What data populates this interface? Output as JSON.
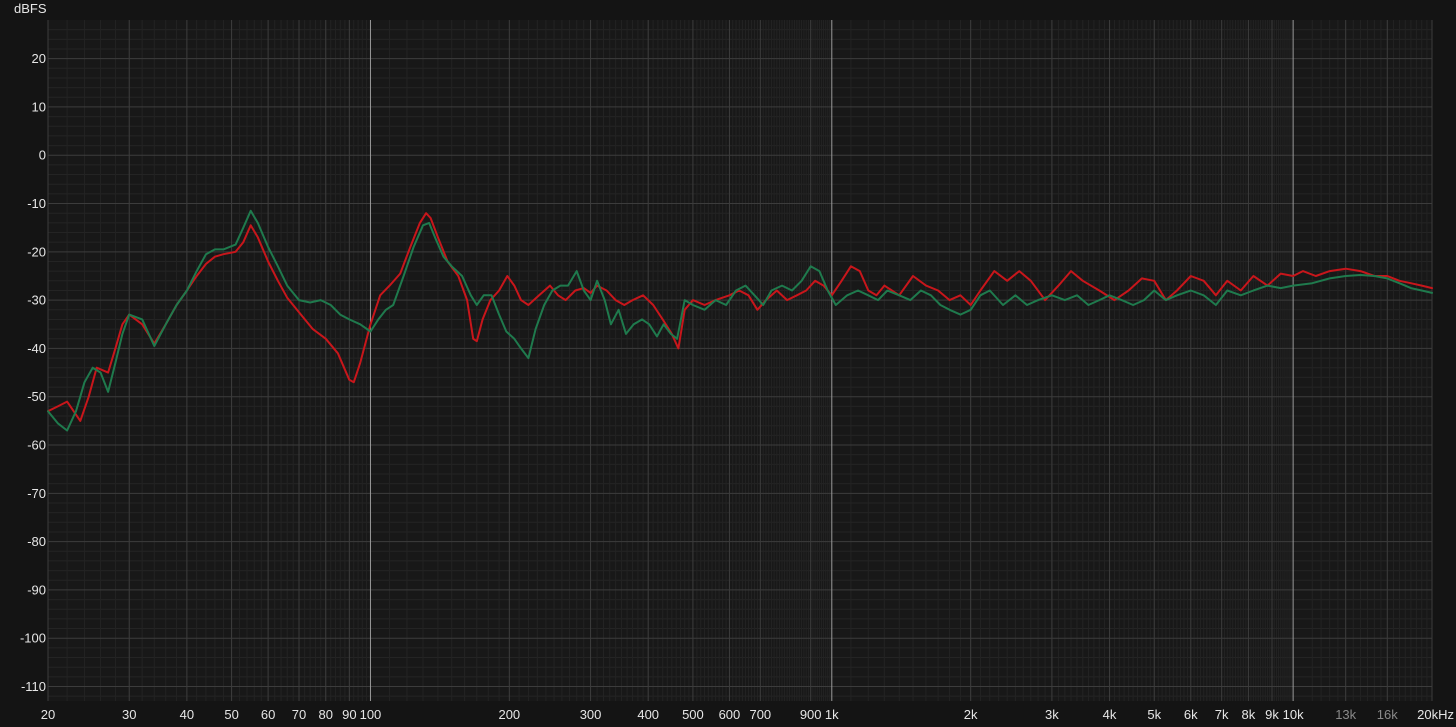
{
  "chart_data": {
    "type": "line",
    "ylabel": "dBFS",
    "xscale": "log",
    "xlim": [
      20,
      20000
    ],
    "ylim": [
      -113,
      28
    ],
    "grid": true,
    "x_ticks": [
      {
        "value": 20,
        "label": "20"
      },
      {
        "value": 30,
        "label": "30"
      },
      {
        "value": 40,
        "label": "40"
      },
      {
        "value": 50,
        "label": "50"
      },
      {
        "value": 60,
        "label": "60"
      },
      {
        "value": 70,
        "label": "70"
      },
      {
        "value": 80,
        "label": "80"
      },
      {
        "value": 90,
        "label": "90"
      },
      {
        "value": 100,
        "label": "100"
      },
      {
        "value": 200,
        "label": "200"
      },
      {
        "value": 300,
        "label": "300"
      },
      {
        "value": 400,
        "label": "400"
      },
      {
        "value": 500,
        "label": "500"
      },
      {
        "value": 600,
        "label": "600"
      },
      {
        "value": 700,
        "label": "700"
      },
      {
        "value": 900,
        "label": "900"
      },
      {
        "value": 1000,
        "label": "1k"
      },
      {
        "value": 2000,
        "label": "2k"
      },
      {
        "value": 3000,
        "label": "3k"
      },
      {
        "value": 4000,
        "label": "4k"
      },
      {
        "value": 5000,
        "label": "5k"
      },
      {
        "value": 6000,
        "label": "6k"
      },
      {
        "value": 7000,
        "label": "7k"
      },
      {
        "value": 8000,
        "label": "8k"
      },
      {
        "value": 9000,
        "label": "9k"
      },
      {
        "value": 10000,
        "label": "10k"
      },
      {
        "value": 13000,
        "label": "13k",
        "dim": true
      },
      {
        "value": 16000,
        "label": "16k",
        "dim": true
      },
      {
        "value": 20000,
        "label": "20kHz"
      }
    ],
    "y_ticks": [
      {
        "value": 20,
        "label": "20"
      },
      {
        "value": 10,
        "label": "10"
      },
      {
        "value": 0,
        "label": "0"
      },
      {
        "value": -10,
        "label": "-10"
      },
      {
        "value": -20,
        "label": "-20"
      },
      {
        "value": -30,
        "label": "-30"
      },
      {
        "value": -40,
        "label": "-40"
      },
      {
        "value": -50,
        "label": "-50"
      },
      {
        "value": -60,
        "label": "-60"
      },
      {
        "value": -70,
        "label": "-70"
      },
      {
        "value": -80,
        "label": "-80"
      },
      {
        "value": -90,
        "label": "-90"
      },
      {
        "value": -100,
        "label": "-100"
      },
      {
        "value": -110,
        "label": "-110"
      }
    ],
    "series": [
      {
        "color": "#c8161b",
        "points": [
          [
            20,
            -53
          ],
          [
            21,
            -52
          ],
          [
            22,
            -51
          ],
          [
            23.5,
            -55
          ],
          [
            24.5,
            -50
          ],
          [
            25.5,
            -44
          ],
          [
            27,
            -45
          ],
          [
            28,
            -40
          ],
          [
            29,
            -35
          ],
          [
            30,
            -33
          ],
          [
            32,
            -35
          ],
          [
            34,
            -39
          ],
          [
            36,
            -35
          ],
          [
            38,
            -31
          ],
          [
            40,
            -28
          ],
          [
            42,
            -25
          ],
          [
            44,
            -22.5
          ],
          [
            46,
            -21
          ],
          [
            48,
            -20.5
          ],
          [
            51,
            -20
          ],
          [
            53,
            -18
          ],
          [
            55,
            -14.5
          ],
          [
            57,
            -17
          ],
          [
            60,
            -22
          ],
          [
            63,
            -26
          ],
          [
            66,
            -29.5
          ],
          [
            70,
            -32.5
          ],
          [
            75,
            -36
          ],
          [
            80,
            -38
          ],
          [
            85,
            -41
          ],
          [
            90,
            -46.5
          ],
          [
            92,
            -47
          ],
          [
            95,
            -43
          ],
          [
            100,
            -35
          ],
          [
            105,
            -29
          ],
          [
            110,
            -27
          ],
          [
            116,
            -24.5
          ],
          [
            122,
            -19
          ],
          [
            128,
            -14
          ],
          [
            132,
            -12
          ],
          [
            135,
            -13
          ],
          [
            140,
            -17
          ],
          [
            147,
            -22
          ],
          [
            155,
            -25
          ],
          [
            162,
            -30
          ],
          [
            167,
            -38
          ],
          [
            170,
            -38.5
          ],
          [
            175,
            -34
          ],
          [
            182,
            -30
          ],
          [
            190,
            -28
          ],
          [
            198,
            -25
          ],
          [
            205,
            -27
          ],
          [
            212,
            -30
          ],
          [
            220,
            -31
          ],
          [
            232,
            -29
          ],
          [
            245,
            -27
          ],
          [
            255,
            -29
          ],
          [
            265,
            -30
          ],
          [
            278,
            -28
          ],
          [
            290,
            -27.5
          ],
          [
            300,
            -28.5
          ],
          [
            310,
            -27
          ],
          [
            325,
            -28
          ],
          [
            340,
            -30
          ],
          [
            355,
            -31
          ],
          [
            370,
            -30
          ],
          [
            390,
            -29
          ],
          [
            410,
            -31
          ],
          [
            430,
            -34
          ],
          [
            450,
            -37
          ],
          [
            465,
            -40
          ],
          [
            480,
            -32
          ],
          [
            500,
            -30
          ],
          [
            530,
            -31
          ],
          [
            560,
            -30
          ],
          [
            600,
            -29
          ],
          [
            630,
            -28
          ],
          [
            660,
            -29
          ],
          [
            690,
            -32
          ],
          [
            720,
            -30
          ],
          [
            760,
            -28
          ],
          [
            800,
            -30
          ],
          [
            840,
            -29
          ],
          [
            880,
            -28
          ],
          [
            920,
            -26
          ],
          [
            960,
            -27
          ],
          [
            1000,
            -29
          ],
          [
            1050,
            -26
          ],
          [
            1100,
            -23
          ],
          [
            1150,
            -24
          ],
          [
            1200,
            -28
          ],
          [
            1250,
            -29
          ],
          [
            1300,
            -27
          ],
          [
            1400,
            -29
          ],
          [
            1500,
            -25
          ],
          [
            1600,
            -27
          ],
          [
            1700,
            -28
          ],
          [
            1800,
            -30
          ],
          [
            1900,
            -29
          ],
          [
            2000,
            -31
          ],
          [
            2100,
            -28
          ],
          [
            2250,
            -24
          ],
          [
            2400,
            -26
          ],
          [
            2550,
            -24
          ],
          [
            2700,
            -26
          ],
          [
            2900,
            -30
          ],
          [
            3100,
            -27
          ],
          [
            3300,
            -24
          ],
          [
            3500,
            -26
          ],
          [
            3800,
            -28
          ],
          [
            4100,
            -30
          ],
          [
            4400,
            -28
          ],
          [
            4700,
            -25.5
          ],
          [
            5000,
            -26
          ],
          [
            5300,
            -30
          ],
          [
            5600,
            -28
          ],
          [
            6000,
            -25
          ],
          [
            6400,
            -26
          ],
          [
            6800,
            -29
          ],
          [
            7200,
            -26
          ],
          [
            7700,
            -28
          ],
          [
            8200,
            -25
          ],
          [
            8800,
            -27
          ],
          [
            9400,
            -24.5
          ],
          [
            10000,
            -25
          ],
          [
            10500,
            -24
          ],
          [
            11200,
            -25
          ],
          [
            12000,
            -24
          ],
          [
            13000,
            -23.5
          ],
          [
            14000,
            -24
          ],
          [
            15000,
            -25
          ],
          [
            16000,
            -25
          ],
          [
            17000,
            -26
          ],
          [
            18000,
            -26.5
          ],
          [
            19000,
            -27
          ],
          [
            20000,
            -27.5
          ]
        ]
      },
      {
        "color": "#1f7a4d",
        "points": [
          [
            20,
            -53
          ],
          [
            21,
            -55.5
          ],
          [
            22,
            -57
          ],
          [
            23,
            -53
          ],
          [
            24,
            -47
          ],
          [
            25,
            -44
          ],
          [
            26,
            -45
          ],
          [
            27,
            -49
          ],
          [
            28,
            -43
          ],
          [
            29,
            -37
          ],
          [
            30,
            -33
          ],
          [
            32,
            -34
          ],
          [
            34,
            -39.5
          ],
          [
            36,
            -35
          ],
          [
            38,
            -31
          ],
          [
            40,
            -28
          ],
          [
            42,
            -24
          ],
          [
            44,
            -20.5
          ],
          [
            46,
            -19.5
          ],
          [
            48,
            -19.5
          ],
          [
            51,
            -18.5
          ],
          [
            53,
            -15
          ],
          [
            55,
            -11.5
          ],
          [
            57,
            -14
          ],
          [
            60,
            -19
          ],
          [
            63,
            -23
          ],
          [
            66,
            -27
          ],
          [
            70,
            -30
          ],
          [
            74,
            -30.5
          ],
          [
            78,
            -30
          ],
          [
            82,
            -31
          ],
          [
            86,
            -33
          ],
          [
            90,
            -34
          ],
          [
            95,
            -35
          ],
          [
            100,
            -36.5
          ],
          [
            104,
            -34
          ],
          [
            108,
            -32
          ],
          [
            112,
            -31
          ],
          [
            118,
            -25
          ],
          [
            124,
            -19
          ],
          [
            130,
            -14.5
          ],
          [
            134,
            -14
          ],
          [
            138,
            -17
          ],
          [
            144,
            -21
          ],
          [
            150,
            -23
          ],
          [
            158,
            -25
          ],
          [
            165,
            -29
          ],
          [
            170,
            -31
          ],
          [
            176,
            -29
          ],
          [
            183,
            -29
          ],
          [
            190,
            -33
          ],
          [
            197,
            -36.5
          ],
          [
            205,
            -38
          ],
          [
            212,
            -40
          ],
          [
            220,
            -42
          ],
          [
            228,
            -36
          ],
          [
            238,
            -31
          ],
          [
            248,
            -28
          ],
          [
            258,
            -27
          ],
          [
            268,
            -27
          ],
          [
            280,
            -24
          ],
          [
            290,
            -28
          ],
          [
            300,
            -30
          ],
          [
            310,
            -26
          ],
          [
            322,
            -30
          ],
          [
            332,
            -35
          ],
          [
            345,
            -32
          ],
          [
            358,
            -37
          ],
          [
            372,
            -35
          ],
          [
            388,
            -34
          ],
          [
            402,
            -35
          ],
          [
            418,
            -37.5
          ],
          [
            432,
            -35
          ],
          [
            448,
            -37
          ],
          [
            462,
            -38
          ],
          [
            480,
            -30
          ],
          [
            500,
            -31
          ],
          [
            530,
            -32
          ],
          [
            560,
            -30
          ],
          [
            590,
            -31
          ],
          [
            620,
            -28
          ],
          [
            650,
            -27
          ],
          [
            680,
            -29
          ],
          [
            710,
            -31
          ],
          [
            740,
            -28
          ],
          [
            780,
            -27
          ],
          [
            820,
            -28
          ],
          [
            860,
            -26
          ],
          [
            900,
            -23
          ],
          [
            940,
            -24
          ],
          [
            980,
            -28
          ],
          [
            1020,
            -31
          ],
          [
            1080,
            -29
          ],
          [
            1140,
            -28
          ],
          [
            1200,
            -29
          ],
          [
            1260,
            -30
          ],
          [
            1320,
            -28
          ],
          [
            1400,
            -29
          ],
          [
            1480,
            -30
          ],
          [
            1560,
            -28
          ],
          [
            1640,
            -29
          ],
          [
            1720,
            -31
          ],
          [
            1800,
            -32
          ],
          [
            1900,
            -33
          ],
          [
            2000,
            -32
          ],
          [
            2100,
            -29
          ],
          [
            2200,
            -28
          ],
          [
            2350,
            -31
          ],
          [
            2500,
            -29
          ],
          [
            2650,
            -31
          ],
          [
            2800,
            -30
          ],
          [
            3000,
            -29
          ],
          [
            3200,
            -30
          ],
          [
            3400,
            -29
          ],
          [
            3600,
            -31
          ],
          [
            3800,
            -30
          ],
          [
            4000,
            -29
          ],
          [
            4250,
            -30
          ],
          [
            4500,
            -31
          ],
          [
            4750,
            -30
          ],
          [
            5000,
            -28
          ],
          [
            5300,
            -30
          ],
          [
            5600,
            -29
          ],
          [
            6000,
            -28
          ],
          [
            6400,
            -29
          ],
          [
            6800,
            -31
          ],
          [
            7200,
            -28
          ],
          [
            7700,
            -29
          ],
          [
            8200,
            -28
          ],
          [
            8800,
            -27
          ],
          [
            9400,
            -27.5
          ],
          [
            10000,
            -27
          ],
          [
            11000,
            -26.5
          ],
          [
            12000,
            -25.5
          ],
          [
            13000,
            -25
          ],
          [
            14000,
            -24.8
          ],
          [
            15000,
            -25
          ],
          [
            16000,
            -25.5
          ],
          [
            17000,
            -26.5
          ],
          [
            18000,
            -27.5
          ],
          [
            19000,
            -28
          ],
          [
            20000,
            -28.5
          ]
        ]
      }
    ]
  }
}
